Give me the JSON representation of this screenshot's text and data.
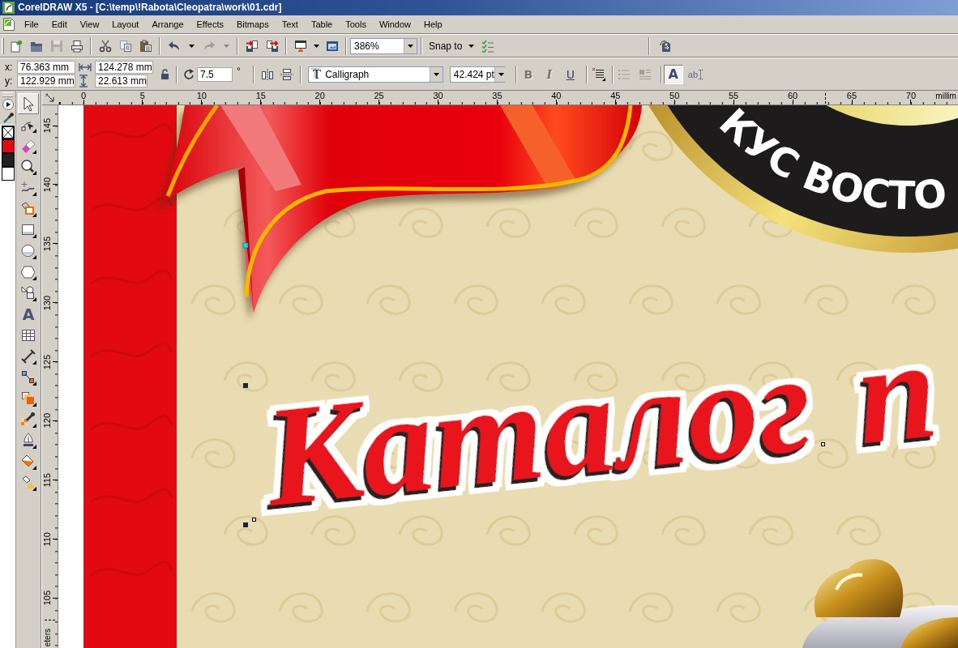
{
  "window": {
    "title": "CorelDRAW X5 - [C:\\temp\\!Rabota\\Cleopatra\\work\\01.cdr]"
  },
  "menu": [
    "File",
    "Edit",
    "View",
    "Layout",
    "Arrange",
    "Effects",
    "Bitmaps",
    "Text",
    "Table",
    "Tools",
    "Window",
    "Help"
  ],
  "standard_toolbar": {
    "buttons": [
      {
        "disabled": false
      },
      {
        "disabled": false
      },
      {
        "disabled": true
      },
      {
        "disabled": false
      },
      {
        "disabled": false
      },
      {
        "disabled": false
      },
      {
        "disabled": false
      },
      {
        "disabled": false
      },
      {
        "disabled": false
      },
      {
        "disabled": true
      },
      {
        "disabled": true
      },
      {
        "disabled": false
      },
      {
        "disabled": false
      },
      {
        "disabled": false
      },
      {
        "disabled": false
      },
      {
        "disabled": false
      }
    ],
    "zoom": "386%",
    "snap_to": "Snap to"
  },
  "property_bar": {
    "x_label": "x:",
    "x": "76.363 mm",
    "y_label": "y:",
    "y": "122.929 mm",
    "width": "124.278 mm",
    "height": "22.613 mm",
    "rotation": "7.5",
    "degree_sign": "°",
    "font_type_glyph": "T",
    "font": "Calligraph",
    "font_size": "42.424 pt",
    "styles": [
      {
        "label": "B",
        "disabled": true
      },
      {
        "label": "I",
        "disabled": true
      },
      {
        "label": "U",
        "disabled": false
      }
    ],
    "paragraph_buttons": [
      {
        "disabled": true
      },
      {
        "disabled": true
      }
    ],
    "edit_text": {
      "label": "A",
      "pressed": true
    },
    "text_type": {
      "label": "ab"
    }
  },
  "palette": [
    {
      "kind": "none"
    },
    {
      "kind": "swatch",
      "color": "#e30613"
    },
    {
      "kind": "swatch",
      "color": "#231f20"
    },
    {
      "kind": "swatch",
      "color": "#ffffff"
    }
  ],
  "toolbox": [
    {
      "selected": true
    },
    {
      "selected": false
    },
    {
      "selected": false
    },
    {
      "selected": false
    },
    {
      "selected": false
    },
    {
      "selected": false
    },
    {
      "selected": false
    },
    {
      "selected": false
    },
    {
      "selected": false
    },
    {
      "selected": false
    },
    {
      "selected": false,
      "glyph": "A"
    },
    {
      "selected": false
    },
    {
      "selected": false
    },
    {
      "selected": false
    },
    {
      "selected": false
    },
    {
      "selected": false
    },
    {
      "selected": false
    },
    {
      "selected": false
    },
    {
      "selected": false
    }
  ],
  "rulers": {
    "horizontal": [
      "0",
      "5",
      "10",
      "15",
      "20",
      "25",
      "30",
      "35",
      "40",
      "45",
      "50",
      "55",
      "60",
      "65",
      "70"
    ],
    "horizontal_unit": "millim",
    "vertical": [
      "145",
      "140",
      "135",
      "130",
      "125",
      "120",
      "115",
      "110",
      "105"
    ],
    "vertical_unit": "eters"
  },
  "canvas": {
    "emblem_words": [
      "КУС",
      "ВОСТО"
    ],
    "heading_words": [
      "Каталог",
      "п"
    ]
  }
}
